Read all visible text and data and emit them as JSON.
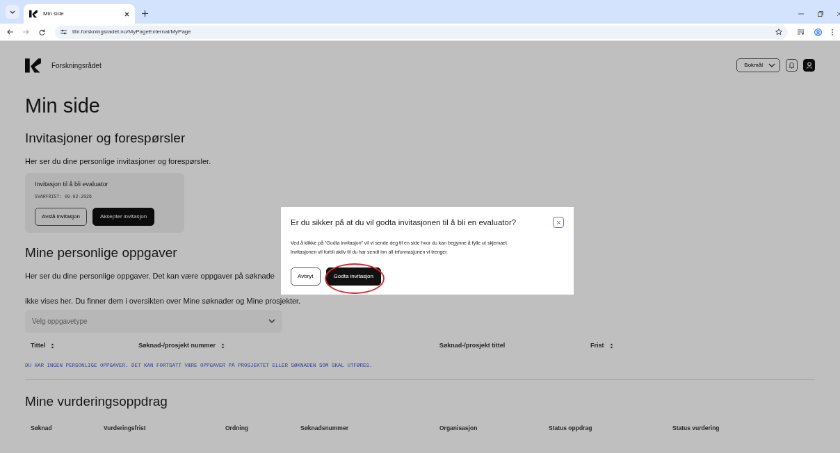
{
  "browser": {
    "tab_title": "Min side",
    "url": "tibi.forskningsradet.no/MyPageExternal/MyPage"
  },
  "header": {
    "brand": "Forskningsrådet",
    "language": "Bokmål"
  },
  "page_title": "Min side",
  "invitations": {
    "heading": "Invitasjoner og forespørsler",
    "intro": "Her ser du dine personlige invitasjoner og forespørsler.",
    "cards": [
      {
        "title": "Invitasjon til å bli evaluator",
        "deadline": "SVARFRIST: 09-02-2026",
        "decline": "Avslå invitasjon",
        "accept": "Aksepter invitasjon"
      }
    ]
  },
  "tasks": {
    "heading": "Mine personlige oppgaver",
    "intro_lines": [
      "Her ser du dine personlige oppgaver. Det kan være oppgaver på søknade",
      "ikke vises her. Du finner dem i oversikten over Mine søknader og Mine prosjekter."
    ],
    "filter": {
      "placeholder": "Velg oppgavetype"
    },
    "columns": [
      {
        "label": "Tittel",
        "sortable": true
      },
      {
        "label": "Søknad-/prosjekt nummer",
        "sortable": true
      },
      {
        "label": "Søknad-/prosjekt tittel",
        "sortable": false
      },
      {
        "label": "Frist",
        "sortable": true
      }
    ],
    "empty_message": "DU HAR INGEN PERSONLIGE OPPGAVER. DET KAN FORTSATT VÆRE OPPGAVER PÅ PROSJEKTET ELLER SØKNADEN SOM SKAL UTFØRES."
  },
  "assessments": {
    "heading": "Mine vurderingsoppdrag",
    "columns": [
      "Søknad",
      "Vurderingsfrist",
      "Ordning",
      "Søknadsnummer",
      "Organisasjon",
      "Status oppdrag",
      "Status vurdering"
    ]
  },
  "modal": {
    "title": "Er du sikker på at du vil godta invitasjonen til å bli en evaluator?",
    "body_lines": [
      "Ved å klikke på “Godta invitasjon” vil vi sende deg til en side hvor du kan begynne å fylle ut skjemaet.",
      "Invitasjonen vil forbli aktiv til du har sendt inn all informasjonen vi trenger."
    ],
    "cancel": "Avbryt",
    "confirm": "Godta invitasjon",
    "confirm_circled": true
  }
}
